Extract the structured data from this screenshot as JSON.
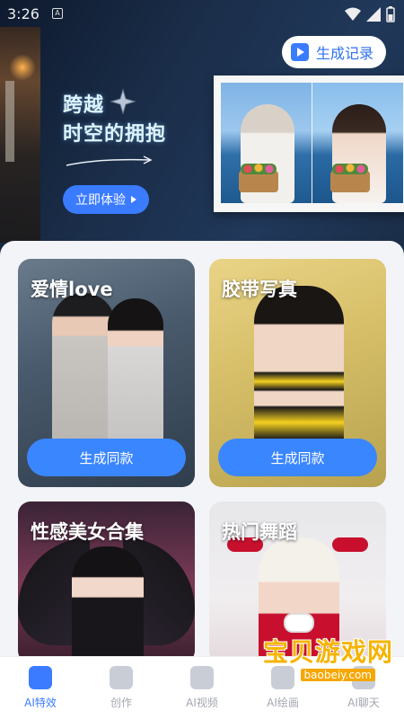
{
  "status_bar": {
    "time": "3:26",
    "notif_icon": "a-notification-icon",
    "wifi_icon": "wifi-icon",
    "signal_icon": "signal-icon",
    "battery_icon": "battery-icon"
  },
  "banner": {
    "history_button": "生成记录",
    "headline_line1": "跨越",
    "headline_line2": "时空的拥抱",
    "try_button": "立即体验"
  },
  "cards": [
    {
      "title": "爱情love",
      "button": "生成同款"
    },
    {
      "title": "胶带写真",
      "button": "生成同款"
    },
    {
      "title": "性感美女合集"
    },
    {
      "title": "热门舞蹈"
    }
  ],
  "bottom_nav": [
    {
      "label": "AI特效",
      "icon": "sparkle-icon",
      "active": true
    },
    {
      "label": "创作",
      "icon": "lightning-icon",
      "active": false
    },
    {
      "label": "AI视频",
      "icon": "video-icon",
      "active": false
    },
    {
      "label": "AI绘画",
      "icon": "paint-icon",
      "active": false
    },
    {
      "label": "AI聊天",
      "icon": "chat-icon",
      "active": false
    }
  ],
  "watermark": {
    "main": "宝贝游戏网",
    "url": "baobeiy.com"
  },
  "colors": {
    "accent": "#3a7bff",
    "nav_inactive": "#a3a7b0"
  }
}
